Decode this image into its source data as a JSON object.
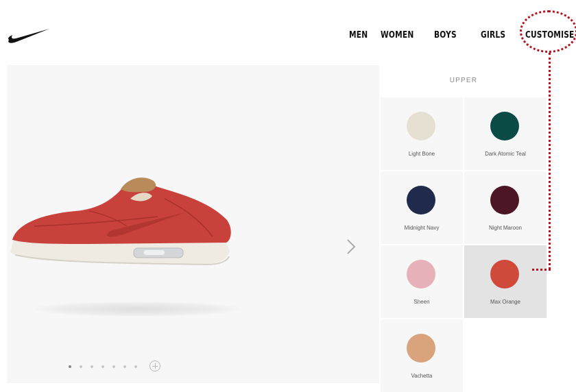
{
  "nav": {
    "items": [
      {
        "label": "MEN"
      },
      {
        "label": "WOMEN"
      },
      {
        "label": "BOYS"
      },
      {
        "label": "GIRLS"
      },
      {
        "label": "CUSTOMISE"
      }
    ],
    "highlighted": "CUSTOMISE",
    "highlight_color": "#b8121e"
  },
  "logo": {
    "icon": "swoosh-logo"
  },
  "stage": {
    "product_color": "#c8413a",
    "carousel": {
      "dot_count": 7,
      "active_index": 0
    },
    "next_icon": "chevron-right-icon",
    "add_icon": "plus-circle-icon"
  },
  "panel": {
    "title": "UPPER",
    "selected": "Max Orange",
    "swatches": [
      {
        "label": "Light Bone",
        "color": "#e6e0d2"
      },
      {
        "label": "Dark Atomic Teal",
        "color": "#0b4a45"
      },
      {
        "label": "Midnight Navy",
        "color": "#1f2a4c"
      },
      {
        "label": "Night Maroon",
        "color": "#4c1624"
      },
      {
        "label": "Sheen",
        "color": "#e6b1b8"
      },
      {
        "label": "Max Orange",
        "color": "#cf4a3b"
      },
      {
        "label": "Vachetta",
        "color": "#d9a47b"
      }
    ]
  }
}
